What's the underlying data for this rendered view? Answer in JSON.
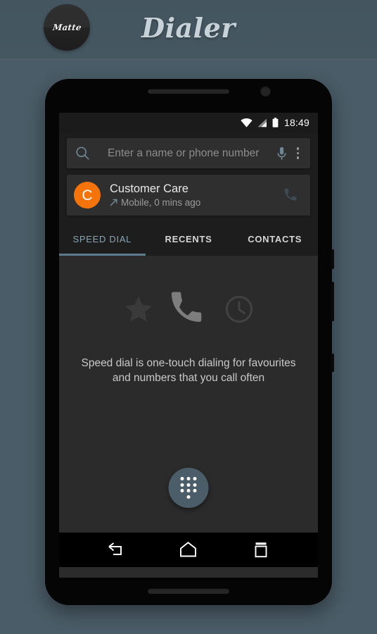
{
  "promo": {
    "brand_badge_label": "Matte",
    "app_title": "Dialer",
    "background_color": "#475863",
    "header_color": "#445560"
  },
  "status_bar": {
    "time": "18:49",
    "icons": [
      "wifi-icon",
      "cellular-signal-icon",
      "battery-icon"
    ]
  },
  "app_bar": {
    "search": {
      "icon": "search-icon",
      "placeholder": "Enter a name or phone number",
      "value": "",
      "voice_icon": "microphone-icon"
    },
    "overflow_menu_icon": "overflow-menu-icon"
  },
  "contact_card": {
    "avatar_letter": "C",
    "avatar_color": "#f4740b",
    "name": "Customer Care",
    "call_direction_icon": "outgoing-call-arrow-icon",
    "subtitle": "Mobile, 0 mins ago",
    "call_action_icon": "phone-icon"
  },
  "tabs": {
    "items": [
      {
        "label": "SPEED DIAL",
        "active": true
      },
      {
        "label": "RECENTS",
        "active": false
      },
      {
        "label": "CONTACTS",
        "active": false
      }
    ],
    "active_indicator_color": "#5d7b8a",
    "active_label_color": "#8aa4b2"
  },
  "speed_dial": {
    "empty_icons": [
      "star-icon",
      "phone-icon",
      "clock-icon"
    ],
    "empty_text": "Speed dial is one-touch dialing for favourites and numbers that you call often",
    "fab": {
      "icon": "dialpad-icon",
      "color": "#4a5d68"
    }
  },
  "nav_bar": {
    "buttons": [
      "back-icon",
      "home-icon",
      "recents-icon"
    ],
    "color": "#000000"
  }
}
